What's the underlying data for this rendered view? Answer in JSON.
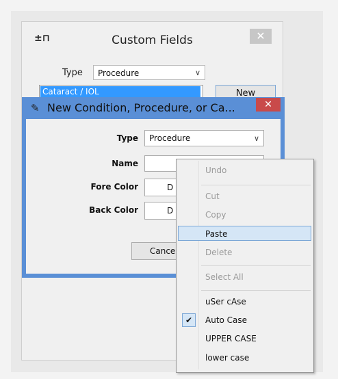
{
  "custom_fields": {
    "title": "Custom Fields",
    "pin_icon": "pin-icon",
    "close_label": "✕",
    "type_label": "Type",
    "type_value": "Procedure",
    "list_items": [
      "Cataract / IOL"
    ],
    "new_button": "New"
  },
  "dialog": {
    "title": "New Condition, Procedure, or Ca...",
    "icon": "notepad-icon",
    "close_label": "✕",
    "type_label": "Type",
    "type_value": "Procedure",
    "name_label": "Name",
    "name_value": "",
    "fore_color_label": "Fore Color",
    "fore_color_value": "D",
    "back_color_label": "Back Color",
    "back_color_value": "D",
    "cancel_button": "Cance"
  },
  "context_menu": {
    "items": [
      {
        "label": "Undo",
        "enabled": false
      },
      {
        "label": "Cut",
        "enabled": false
      },
      {
        "label": "Copy",
        "enabled": false
      },
      {
        "label": "Paste",
        "enabled": true,
        "highlighted": true
      },
      {
        "label": "Delete",
        "enabled": false
      },
      {
        "label": "Select All",
        "enabled": false
      },
      {
        "label": "uSer cAse",
        "enabled": true
      },
      {
        "label": "Auto Case",
        "enabled": true,
        "checked": true
      },
      {
        "label": "UPPER CASE",
        "enabled": true
      },
      {
        "label": "lower case",
        "enabled": true
      }
    ],
    "check_mark": "✔"
  },
  "colors": {
    "dialog_frame": "#5a8fd6",
    "close_red": "#c94a4a",
    "selection_blue": "#3399ff",
    "menu_highlight": "#d5e6f6"
  }
}
